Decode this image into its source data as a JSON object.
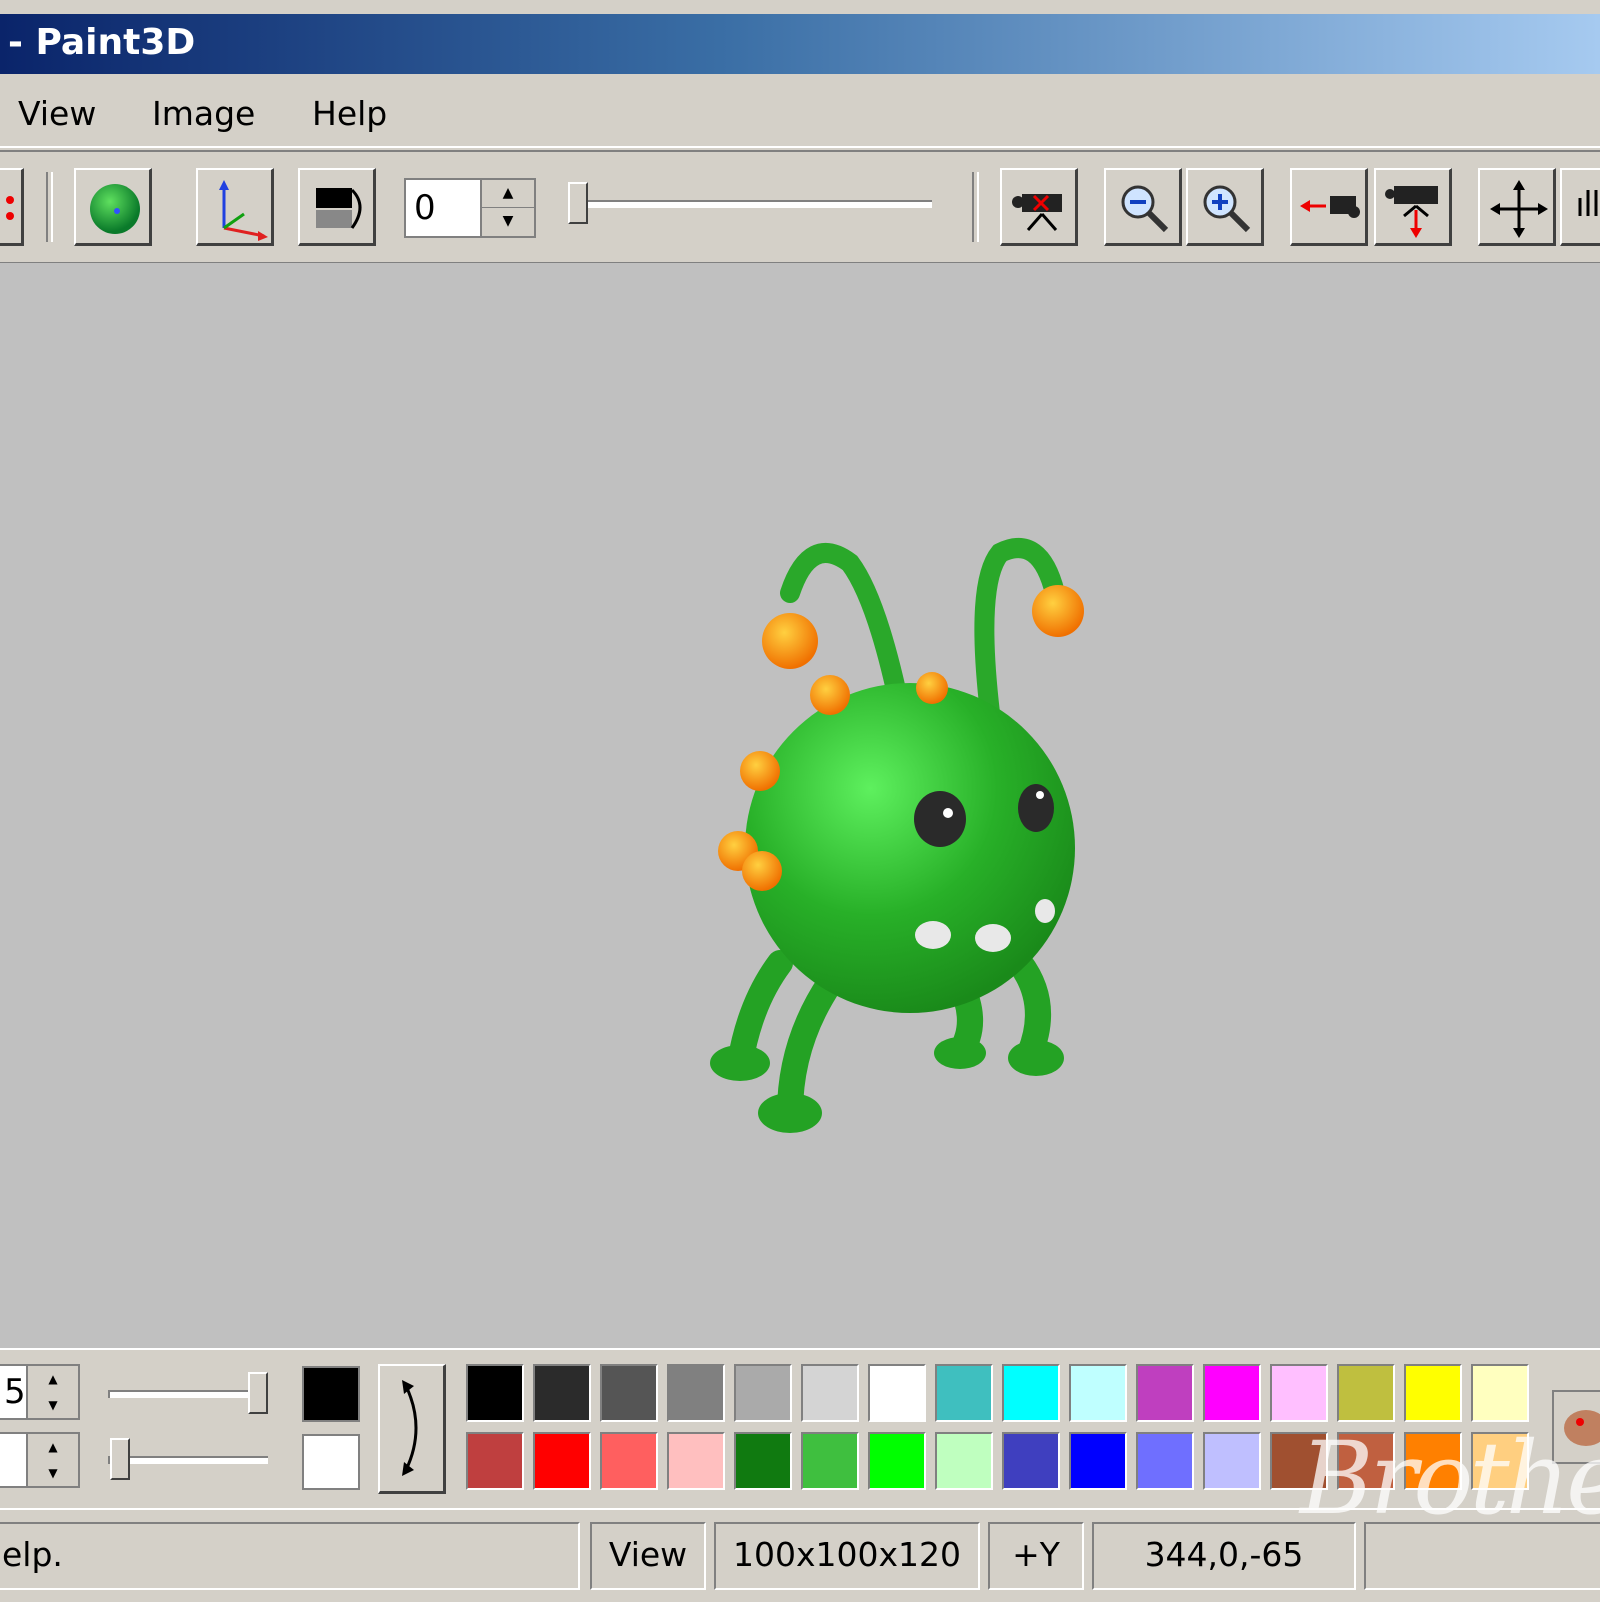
{
  "window": {
    "title": "- Paint3D"
  },
  "menu": {
    "items": [
      "View",
      "Image",
      "Help"
    ]
  },
  "toolbar": {
    "spin_value": "0",
    "buttons": [
      "sphere",
      "axes",
      "fill-pattern",
      "camera-delete",
      "zoom-out",
      "zoom-in",
      "camera-left",
      "camera-down",
      "move",
      "pan"
    ]
  },
  "bottom": {
    "spin1_value": "5",
    "spin2_value": "",
    "foreground_color": "#000000",
    "background_color": "#ffffff",
    "palette_row1": [
      "#000000",
      "#2b2b2b",
      "#555555",
      "#808080",
      "#aaaaaa",
      "#d4d4d4",
      "#ffffff",
      "#3fbfbf",
      "#00ffff",
      "#bfffff",
      "#bf3fbf",
      "#ff00ff",
      "#ffbfff",
      "#bfbf3f",
      "#ffff00",
      "#ffffbf"
    ],
    "palette_row2": [
      "#bf3f3f",
      "#ff0000",
      "#ff5f5f",
      "#ffbfbf",
      "#107a10",
      "#3fbf3f",
      "#00ff00",
      "#bfffbf",
      "#3f3fbf",
      "#0000ff",
      "#6f6fff",
      "#bfbfff",
      "#a05030",
      "#c06040",
      "#ff8000",
      "#ffcf80"
    ]
  },
  "status": {
    "help": "elp.",
    "mode": "View",
    "dimensions": "100x100x120",
    "axis": "+Y",
    "coords": "344,0,-65"
  },
  "watermark": {
    "text": "Brothe"
  }
}
